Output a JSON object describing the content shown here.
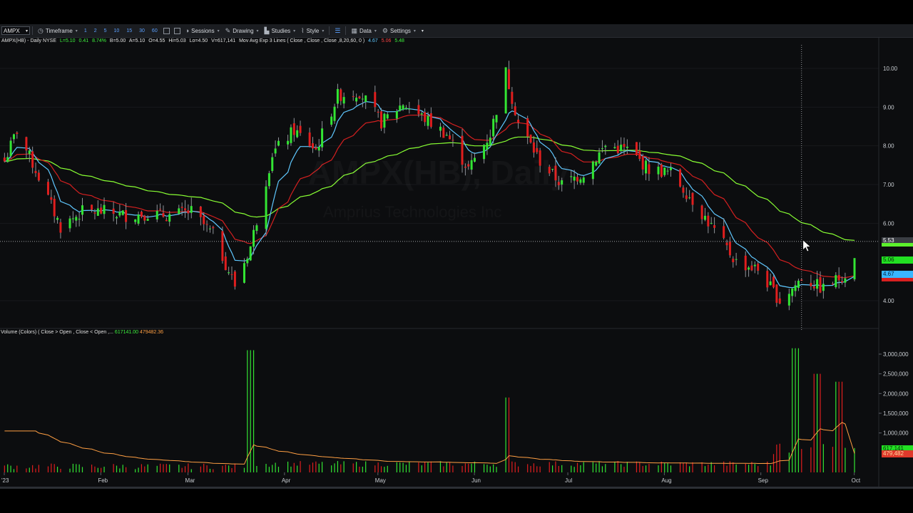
{
  "toolbar": {
    "symbol": "AMPX",
    "timeframe_label": "Timeframe",
    "timeframes": [
      "1",
      "2",
      "5",
      "10",
      "15",
      "30",
      "60"
    ],
    "sessions_label": "Sessions",
    "drawing_label": "Drawing",
    "studies_label": "Studies",
    "style_label": "Style",
    "data_label": "Data",
    "settings_label": "Settings"
  },
  "legend": {
    "instrument": "AMPX(HB) - Daily  NYSE",
    "last": "L=5.10",
    "change": "0.41",
    "change_pct": "8.74%",
    "bid": "B=5.00",
    "ask": "A=5.10",
    "open": "O=4.55",
    "high": "Hi=5.03",
    "low": "Lo=4.50",
    "volume": "V=617,141",
    "ma_label": "Mov Avg Exp 3 Lines ( Close , Close , Close ,8,20,60, 0 )",
    "ma_fast": "4.67",
    "ma_mid": "5.06",
    "ma_slow": "5.48"
  },
  "volume_legend": {
    "label": "Volume (Colors) ( Close > Open , Close < Open ,...",
    "value": "617141.00",
    "avg": "479482.36"
  },
  "watermark": {
    "title": "AMPX(HB), Daily",
    "company": "Amprius Technologies Inc"
  },
  "price_axis": {
    "ticks": [
      "10.00",
      "9.00",
      "8.00",
      "7.00",
      "6.00",
      "4.00"
    ],
    "crosshair": "5.53",
    "slow_ma_badge": "5.06",
    "fast_ma_badge": "4.67"
  },
  "volume_axis": {
    "ticks": [
      "3,000,000",
      "2,500,000",
      "2,000,000",
      "1,500,000",
      "1,000,000"
    ],
    "volume_badge": "617,141",
    "avg_badge": "479,482"
  },
  "time_axis": {
    "labels": [
      "'23",
      "Feb",
      "Mar",
      "Apr",
      "May",
      "Jun",
      "Jul",
      "Aug",
      "Sep",
      "Oct"
    ]
  },
  "colors": {
    "up": "#33e533",
    "down": "#e01e1e",
    "ma_fast": "#5fc8ff",
    "ma_mid": "#d42020",
    "ma_slow": "#88ff33",
    "vol_avg": "#ff9f43"
  },
  "chart_data": {
    "type": "candlestick",
    "symbol": "AMPX(HB)",
    "interval": "Daily",
    "ylim": [
      3.4,
      10.6
    ],
    "close_path": [
      {
        "date": "2023-01-01",
        "close": 7.4
      },
      {
        "date": "2023-01-06",
        "close": 8.4
      },
      {
        "date": "2023-01-13",
        "close": 7.2
      },
      {
        "date": "2023-01-20",
        "close": 5.9
      },
      {
        "date": "2023-01-27",
        "close": 6.3
      },
      {
        "date": "2023-02-03",
        "close": 6.3
      },
      {
        "date": "2023-02-10",
        "close": 6.2
      },
      {
        "date": "2023-02-17",
        "close": 6.25
      },
      {
        "date": "2023-02-24",
        "close": 6.2
      },
      {
        "date": "2023-03-03",
        "close": 6.3
      },
      {
        "date": "2023-03-10",
        "close": 5.7
      },
      {
        "date": "2023-03-17",
        "close": 4.4
      },
      {
        "date": "2023-03-22",
        "close": 5.4
      },
      {
        "date": "2023-03-29",
        "close": 7.8
      },
      {
        "date": "2023-04-05",
        "close": 8.4
      },
      {
        "date": "2023-04-12",
        "close": 7.9
      },
      {
        "date": "2023-04-19",
        "close": 9.3
      },
      {
        "date": "2023-04-26",
        "close": 9.4
      },
      {
        "date": "2023-05-03",
        "close": 8.6
      },
      {
        "date": "2023-05-10",
        "close": 9.1
      },
      {
        "date": "2023-05-17",
        "close": 8.7
      },
      {
        "date": "2023-05-24",
        "close": 8.3
      },
      {
        "date": "2023-05-31",
        "close": 7.4
      },
      {
        "date": "2023-06-07",
        "close": 8.3
      },
      {
        "date": "2023-06-12",
        "close": 9.9
      },
      {
        "date": "2023-06-16",
        "close": 8.6
      },
      {
        "date": "2023-06-23",
        "close": 7.6
      },
      {
        "date": "2023-06-30",
        "close": 7.0
      },
      {
        "date": "2023-07-07",
        "close": 7.3
      },
      {
        "date": "2023-07-14",
        "close": 8.0
      },
      {
        "date": "2023-07-21",
        "close": 7.9
      },
      {
        "date": "2023-07-28",
        "close": 7.4
      },
      {
        "date": "2023-08-04",
        "close": 7.3
      },
      {
        "date": "2023-08-11",
        "close": 6.6
      },
      {
        "date": "2023-08-18",
        "close": 5.8
      },
      {
        "date": "2023-08-25",
        "close": 5.0
      },
      {
        "date": "2023-09-01",
        "close": 4.8
      },
      {
        "date": "2023-09-08",
        "close": 4.0
      },
      {
        "date": "2023-09-13",
        "close": 4.4
      },
      {
        "date": "2023-09-15",
        "close": 4.6
      },
      {
        "date": "2023-09-22",
        "close": 4.3
      },
      {
        "date": "2023-09-29",
        "close": 4.7
      },
      {
        "date": "2023-10-02",
        "close": 5.1
      }
    ],
    "last_bar": {
      "open": 4.55,
      "high": 5.03,
      "low": 4.5,
      "close": 5.1,
      "volume": 617141
    },
    "moving_averages": [
      {
        "name": "EMA 8",
        "last": 4.67
      },
      {
        "name": "EMA 20",
        "last": 5.06
      },
      {
        "name": "EMA 60",
        "last": 5.48
      }
    ],
    "volume_avg": 479482.36,
    "volume_ylim": [
      0,
      3000000
    ],
    "volume_spikes": [
      {
        "date": "2023-03-22",
        "volume": 3100000
      },
      {
        "date": "2023-06-12",
        "volume": 1900000
      },
      {
        "date": "2023-09-13",
        "volume": 3500000
      },
      {
        "date": "2023-09-20",
        "volume": 2500000
      },
      {
        "date": "2023-09-27",
        "volume": 2300000
      }
    ]
  }
}
